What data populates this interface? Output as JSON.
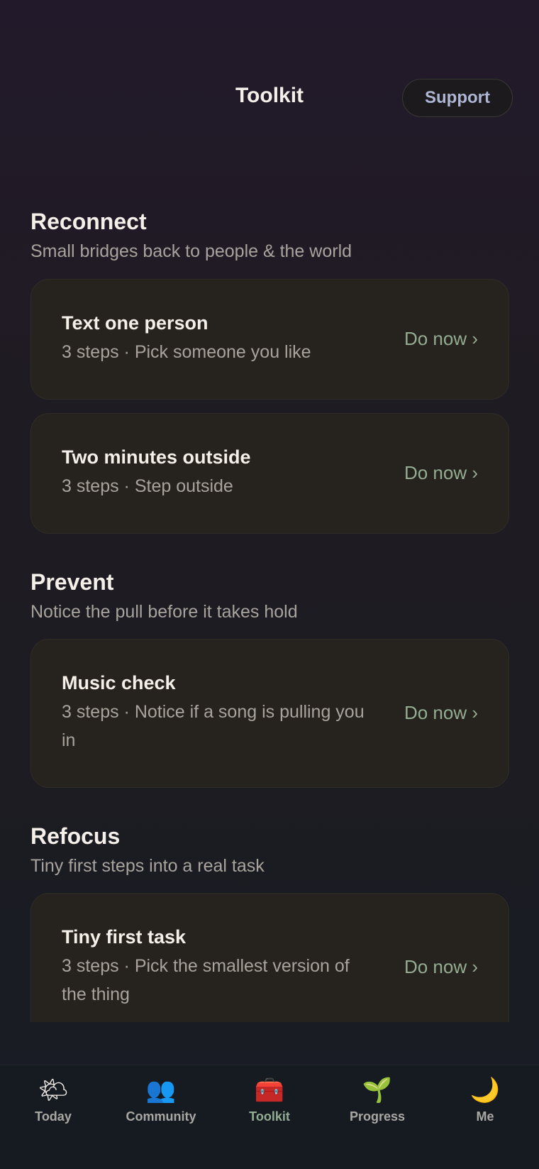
{
  "header": {
    "title": "Toolkit",
    "support_label": "Support"
  },
  "sections": [
    {
      "title": "Reconnect",
      "subtitle": "Small bridges back to people & the world",
      "cards": [
        {
          "title": "Text one person",
          "meta": "3 steps · Pick someone you like",
          "action": "Do now ›"
        },
        {
          "title": "Two minutes outside",
          "meta": "3 steps · Step outside",
          "action": "Do now ›"
        }
      ]
    },
    {
      "title": "Prevent",
      "subtitle": "Notice the pull before it takes hold",
      "cards": [
        {
          "title": "Music check",
          "meta": "3 steps · Notice if a song is pulling you in",
          "action": "Do now ›"
        }
      ]
    },
    {
      "title": "Refocus",
      "subtitle": "Tiny first steps into a real task",
      "cards": [
        {
          "title": "Tiny first task",
          "meta": "3 steps · Pick the smallest version of the thing",
          "action": "Do now ›"
        }
      ]
    }
  ],
  "tabbar": {
    "active": "Toolkit",
    "tabs": [
      {
        "label": "Today",
        "icon": "sun-behind-cloud-icon",
        "glyph": "🌤"
      },
      {
        "label": "Community",
        "icon": "people-icon",
        "glyph": "👥"
      },
      {
        "label": "Toolkit",
        "icon": "toolbox-icon",
        "glyph": "🧰"
      },
      {
        "label": "Progress",
        "icon": "seedling-icon",
        "glyph": "🌱"
      },
      {
        "label": "Me",
        "icon": "crescent-moon-icon",
        "glyph": "🌙"
      }
    ]
  },
  "colors": {
    "accent": "#93ad93",
    "support_text": "#aeb6d4",
    "card_bg": "#26221d",
    "tabbar_bg": "#161b22"
  }
}
